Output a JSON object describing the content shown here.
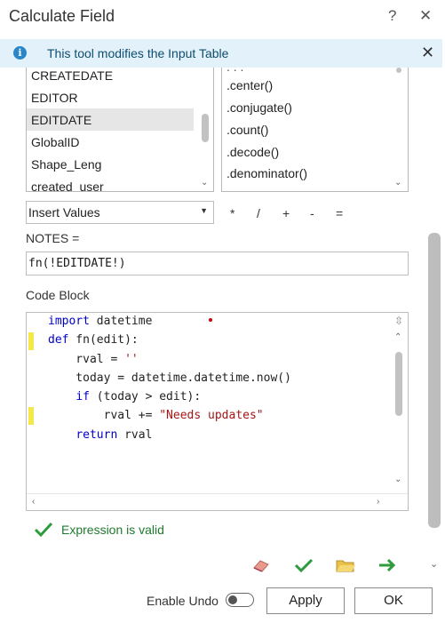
{
  "window": {
    "title": "Calculate Field",
    "help_glyph": "?",
    "close_glyph": "✕"
  },
  "info_bar": {
    "message": "This tool modifies the Input Table",
    "icon": "info-icon",
    "close_glyph": "✕"
  },
  "fields_list": {
    "items": [
      "CREATEDATE",
      "EDITOR",
      "EDITDATE",
      "GlobalID",
      "Shape_Leng",
      "created_user"
    ],
    "selected": "EDITDATE"
  },
  "helpers_list": {
    "items": [
      ".center()",
      ".conjugate()",
      ".count()",
      ".decode()",
      ".denominator()"
    ]
  },
  "insert_values": {
    "selected": "Insert Values"
  },
  "operators": [
    "*",
    "/",
    "+",
    "-",
    "="
  ],
  "expression": {
    "label": "NOTES =",
    "value": "fn(!EDITDATE!)"
  },
  "code_block": {
    "label": "Code Block",
    "lines": {
      "l1": {
        "kw": "import",
        "rest": " datetime"
      },
      "l2": {
        "kw": "def",
        "rest": " fn(edit):"
      },
      "l3": {
        "pre": "    rval = ",
        "str": "''"
      },
      "l4": {
        "pre": "    today = datetime.datetime.now()"
      },
      "l5": {
        "pre": "    ",
        "kw": "if",
        "rest": " (today > edit):"
      },
      "l6": {
        "pre": "        rval += ",
        "str": "\"Needs updates\""
      },
      "l7": {
        "pre": "    ",
        "kw": "return",
        "rest": " rval"
      }
    }
  },
  "status": {
    "message": "Expression is valid",
    "color": "#1f7a2e"
  },
  "footer": {
    "enable_undo_label": "Enable Undo",
    "enable_undo_on": false,
    "apply_label": "Apply",
    "ok_label": "OK"
  },
  "colors": {
    "accent": "#2a87c7",
    "keyword": "#0000cc",
    "string": "#a31515",
    "marker": "#f5e94a",
    "info_bg": "#e3f1fa"
  }
}
